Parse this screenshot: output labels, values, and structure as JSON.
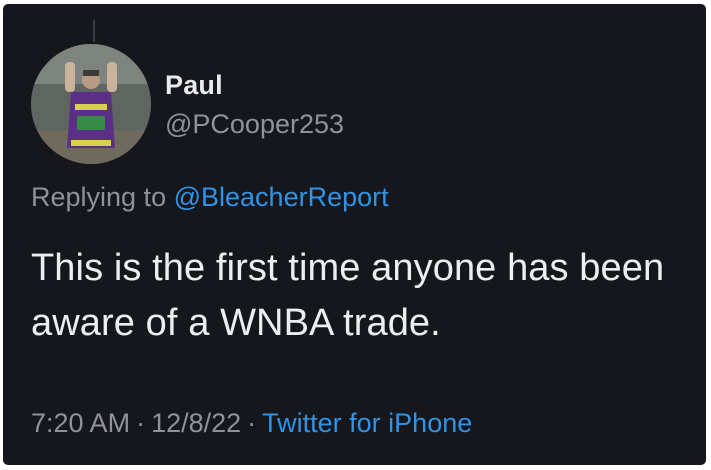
{
  "author": {
    "display_name": "Paul",
    "handle": "@PCooper253"
  },
  "reply": {
    "prefix": "Replying to",
    "mention": "@BleacherReport"
  },
  "tweet": {
    "text": "This is the first time anyone has been aware of a WNBA trade."
  },
  "meta": {
    "time": "7:20 AM",
    "date": "12/8/22",
    "separator": "·",
    "source": "Twitter for iPhone"
  },
  "colors": {
    "background": "#15171c",
    "link": "#2f93e6",
    "secondary_text": "#8d939b",
    "primary_text": "#eceef0"
  },
  "icons": {
    "avatar": "profile-photo"
  }
}
